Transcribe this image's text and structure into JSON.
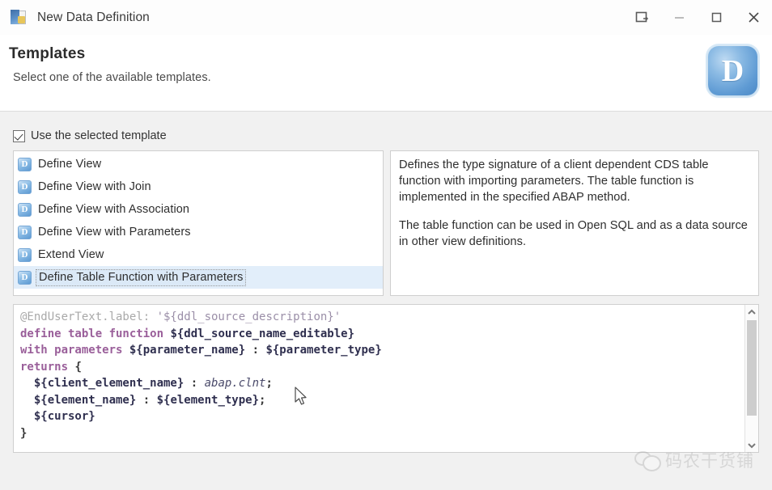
{
  "window": {
    "title": "New Data Definition",
    "app_icon": "data-definition-icon",
    "controls": {
      "help": "help-icon",
      "minimize": "minimize-button",
      "maximize": "maximize-button",
      "close": "close-button"
    }
  },
  "header": {
    "title": "Templates",
    "subtitle": "Select one of the available templates.",
    "logo_letter": "D",
    "logo_color": "#5f9bd4"
  },
  "options": {
    "use_template_label": "Use the selected template",
    "use_template_checked": true
  },
  "templates": {
    "items": [
      {
        "label": "Define View",
        "selected": false
      },
      {
        "label": "Define View with Join",
        "selected": false
      },
      {
        "label": "Define View with Association",
        "selected": false
      },
      {
        "label": "Define View with Parameters",
        "selected": false
      },
      {
        "label": "Extend View",
        "selected": false
      },
      {
        "label": "Define Table Function with Parameters",
        "selected": true
      }
    ],
    "item_icon": "cds-template-icon",
    "icon_letter": "D",
    "selected_index": 5,
    "selection_color": "#e2eefa"
  },
  "description": {
    "paragraph1": "Defines the type signature of a client dependent CDS table function with importing parameters. The table function is implemented in the specified ABAP method.",
    "paragraph2": "The table function can be used in Open SQL and as a data source in other view definitions."
  },
  "code_preview": {
    "lines": [
      {
        "tokens": [
          {
            "t": "@EndUserText.label: ",
            "c": "c-ann"
          },
          {
            "t": "'${ddl_source_description}'",
            "c": "c-str"
          }
        ]
      },
      {
        "tokens": [
          {
            "t": "define table function ",
            "c": "c-kw"
          },
          {
            "t": "${ddl_source_name_editable}",
            "c": "c-var"
          }
        ]
      },
      {
        "tokens": [
          {
            "t": "with parameters ",
            "c": "c-kw"
          },
          {
            "t": "${parameter_name}",
            "c": "c-var"
          },
          {
            "t": " : ",
            "c": "c-plain"
          },
          {
            "t": "${parameter_type}",
            "c": "c-var"
          }
        ]
      },
      {
        "tokens": [
          {
            "t": "returns",
            "c": "c-kw"
          },
          {
            "t": " {",
            "c": "c-plain"
          }
        ]
      },
      {
        "tokens": [
          {
            "t": "  ",
            "c": "c-plain"
          },
          {
            "t": "${client_element_name}",
            "c": "c-var"
          },
          {
            "t": " : ",
            "c": "c-plain"
          },
          {
            "t": "abap.clnt",
            "c": "c-type"
          },
          {
            "t": ";",
            "c": "c-plain"
          }
        ]
      },
      {
        "tokens": [
          {
            "t": "  ",
            "c": "c-plain"
          },
          {
            "t": "${element_name}",
            "c": "c-var"
          },
          {
            "t": " : ",
            "c": "c-plain"
          },
          {
            "t": "${element_type}",
            "c": "c-var"
          },
          {
            "t": ";",
            "c": "c-plain"
          }
        ]
      },
      {
        "tokens": [
          {
            "t": "  ",
            "c": "c-plain"
          },
          {
            "t": "${cursor}",
            "c": "c-var"
          }
        ]
      },
      {
        "tokens": [
          {
            "t": "}",
            "c": "c-plain"
          }
        ]
      }
    ],
    "scrollbar": {
      "up_icon": "chevron-up-icon",
      "down_icon": "chevron-down-icon"
    }
  },
  "watermark": {
    "text": "码农干货铺",
    "logo": "wechat-icon"
  }
}
